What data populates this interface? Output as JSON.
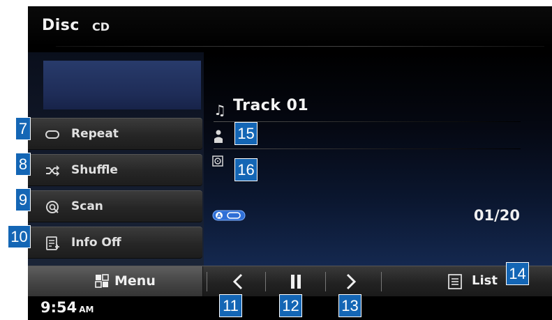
{
  "header": {
    "title": "Disc",
    "subtitle": "CD"
  },
  "sidebar": {
    "buttons": [
      {
        "label": "Repeat",
        "icon": "repeat-icon"
      },
      {
        "label": "Shuffle",
        "icon": "shuffle-icon"
      },
      {
        "label": "Scan",
        "icon": "scan-icon"
      },
      {
        "label": "Info Off",
        "icon": "info-icon"
      }
    ]
  },
  "now_playing": {
    "track_title": "Track 01",
    "track_counter": "01/20",
    "icons": [
      "music-note-icon",
      "artist-icon",
      "album-icon",
      "ab-repeat-icon"
    ]
  },
  "bottom_bar": {
    "menu_label": "Menu",
    "list_label": "List",
    "controls": [
      "previous-track",
      "pause",
      "next-track"
    ]
  },
  "status": {
    "time": "9:54",
    "ampm": "AM"
  },
  "callouts": {
    "c7": "7",
    "c8": "8",
    "c9": "9",
    "c10": "10",
    "c11": "11",
    "c12": "12",
    "c13": "13",
    "c14": "14",
    "c15": "15",
    "c16": "16"
  },
  "colors": {
    "callout": "#1466b5",
    "screen_bg": "#000000",
    "accent_blue": "#14284f"
  }
}
